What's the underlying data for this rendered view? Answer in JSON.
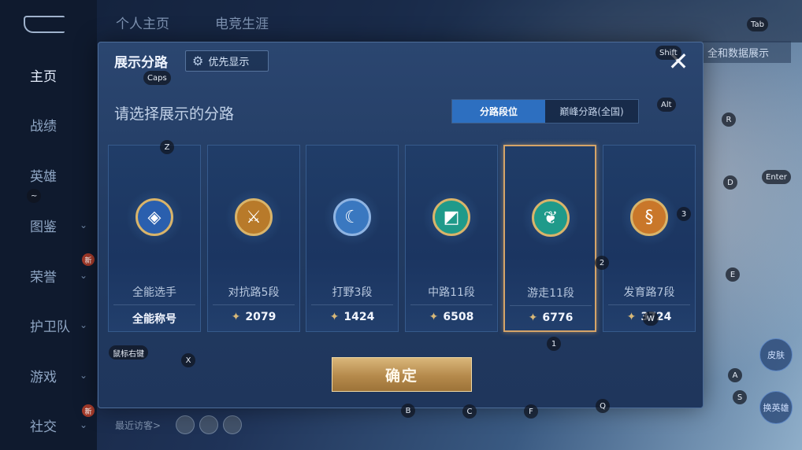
{
  "sidebar": {
    "items": [
      {
        "label": "主页",
        "active": true
      },
      {
        "label": "战绩"
      },
      {
        "label": "英雄"
      },
      {
        "label": "图鉴"
      },
      {
        "label": "荣誉",
        "badge": "新"
      },
      {
        "label": "护卫队"
      },
      {
        "label": "游戏"
      },
      {
        "label": "社交",
        "badge": "新"
      }
    ]
  },
  "topbar": {
    "tabs": [
      "个人主页",
      "电竞生涯"
    ],
    "right_menu": "全和数据展示"
  },
  "right_buttons": [
    "皮肤",
    "换英雄"
  ],
  "visitors": {
    "label": "最近访客>"
  },
  "modal": {
    "title": "展示分路",
    "priority_button": "优先显示",
    "subtitle": "请选择展示的分路",
    "tabs": [
      {
        "label": "分路段位",
        "active": true
      },
      {
        "label": "巅峰分路(全国)",
        "active": false
      }
    ],
    "cards": [
      {
        "rank": "全能选手",
        "score": "全能称号",
        "icon": "allround-emblem-icon",
        "has_score_icon": false,
        "selected": false,
        "color": "#2a5fae"
      },
      {
        "rank": "对抗路5段",
        "score": "2079",
        "icon": "clash-lane-emblem-icon",
        "has_score_icon": true,
        "selected": false,
        "color": "#b87a2a"
      },
      {
        "rank": "打野3段",
        "score": "1424",
        "icon": "jungle-emblem-icon",
        "has_score_icon": true,
        "selected": false,
        "color": "#3a78c0"
      },
      {
        "rank": "中路11段",
        "score": "6508",
        "icon": "mid-lane-emblem-icon",
        "has_score_icon": true,
        "selected": false,
        "color": "#1f9a8a"
      },
      {
        "rank": "游走11段",
        "score": "6776",
        "icon": "roam-emblem-icon",
        "has_score_icon": true,
        "selected": true,
        "color": "#1f9a8a"
      },
      {
        "rank": "发育路7段",
        "score": "3724",
        "icon": "farm-lane-emblem-icon",
        "has_score_icon": true,
        "selected": false,
        "color": "#c9772a"
      }
    ],
    "confirm_button": "确定"
  },
  "key_hints": {
    "tab": "Tab",
    "shift": "Shift",
    "caps": "Caps",
    "alt": "Alt",
    "r": "R",
    "d": "D",
    "enter": "Enter",
    "z": "Z",
    "tilde": "~",
    "three": "3",
    "two": "2",
    "e": "E",
    "one": "1",
    "w": "W",
    "right_click": "鼠标右键",
    "x": "X",
    "a": "A",
    "s": "S",
    "b": "B",
    "c": "C",
    "f": "F",
    "q": "Q"
  }
}
